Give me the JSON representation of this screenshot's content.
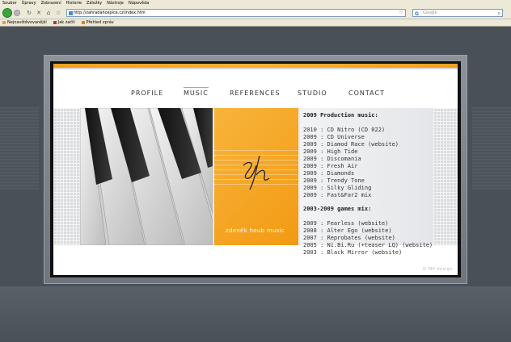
{
  "browser": {
    "menu": [
      "Soubor",
      "Úpravy",
      "Zobrazení",
      "Historie",
      "Záložky",
      "Nástroje",
      "Nápověda"
    ],
    "url": "http://zahradahospice.cz/index.htm",
    "search_placeholder": "Google",
    "bookmarks": [
      "Nejnavštěvovanější",
      "Jak začít",
      "Přehled zpráv"
    ]
  },
  "site": {
    "nav": [
      "PROFILE",
      "MUSIC",
      "REFERENCES",
      "STUDIO",
      "CONTACT"
    ],
    "active_nav": "MUSIC",
    "orange_caption": "zdeněk houb music",
    "credit": "© MP design",
    "accent_color": "#f0a020",
    "sections": [
      {
        "title": "2009 Production music:",
        "items": [
          "2010 : CD Nitro (CD 022)",
          "2009 : CD Universe",
          "2009 : Diamod Race (website)",
          "2009 : High Tide",
          "2009 : Discomania",
          "2009 : Fresh Air",
          "2009 : Diamonds",
          "2009 : Trendy Tone",
          "2009 : Silky Gliding",
          "2009 : Fast&Far2 mix"
        ]
      },
      {
        "title": "2003-2009 games mix:",
        "items": [
          "2009 : Fearless (website)",
          "2008 : Alter Ego (website)",
          "2007 : Reprobates (website)",
          "2005 : Ni.Bi.Ru (+teaser LQ) (website)",
          "2003 : Black Mirror (website)"
        ]
      }
    ]
  }
}
